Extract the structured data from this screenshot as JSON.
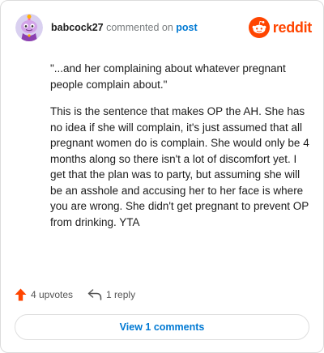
{
  "comment": {
    "username": "babcock27",
    "action_text": "commented on",
    "post_link": "post",
    "paragraphs": [
      "\"...and her complaining about whatever pregnant people complain about.\"",
      "This is the sentence that makes OP the AH. She has no idea if she will complain, it's just assumed that all pregnant women do is complain. She would only be 4 months along so there isn't a lot of discomfort yet. I get that the plan was to party, but assuming she will be an asshole and accusing her to her face is where you are wrong. She didn't get pregnant to prevent OP from drinking. YTA"
    ]
  },
  "brand": {
    "name": "reddit",
    "icon": "reddit-snoo-icon",
    "color": "#ff4500"
  },
  "actions": {
    "upvotes_label": "4 upvotes",
    "upvote_icon": "upvote-arrow-icon",
    "reply_label": "1 reply",
    "reply_icon": "reply-arrow-icon"
  },
  "footer": {
    "view_comments_label": "View 1 comments"
  },
  "colors": {
    "link_blue": "#0079d3",
    "upvote_orange": "#ff4500",
    "muted_text": "#787c7e"
  }
}
